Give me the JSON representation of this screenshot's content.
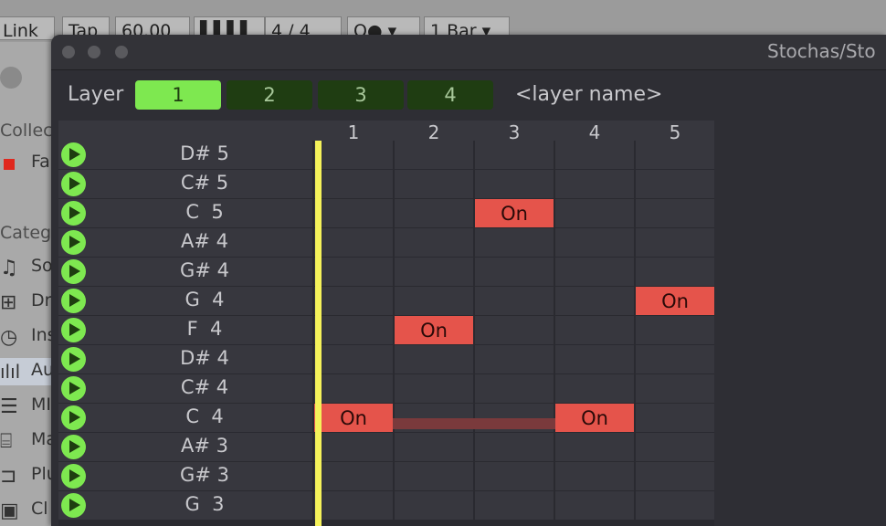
{
  "host": {
    "toolbar": [
      "Link",
      "Tap",
      "60.00",
      "4 / 4",
      "1 Bar"
    ],
    "sidebar": {
      "collections_header": "Collec",
      "collection_item": "Fa",
      "categories_header": "Categ",
      "items": [
        "So",
        "Dr",
        "Ins",
        "Au",
        "MI",
        "Ma",
        "Plu",
        "Cl"
      ]
    }
  },
  "window": {
    "title": "Stochas/Sto"
  },
  "layer": {
    "label": "Layer",
    "tabs": [
      "1",
      "2",
      "3",
      "4"
    ],
    "active_tab": 0,
    "name_placeholder": "<layer name>"
  },
  "grid": {
    "columns": [
      "1",
      "2",
      "3",
      "4",
      "5"
    ],
    "on_label": "On",
    "rows": [
      {
        "note": "D# 5",
        "on": []
      },
      {
        "note": "C# 5",
        "on": []
      },
      {
        "note": "C  5",
        "on": [
          3
        ]
      },
      {
        "note": "A# 4",
        "on": []
      },
      {
        "note": "G# 4",
        "on": []
      },
      {
        "note": "G  4",
        "on": [
          5
        ]
      },
      {
        "note": "F  4",
        "on": [
          2
        ]
      },
      {
        "note": "D# 4",
        "on": []
      },
      {
        "note": "C# 4",
        "on": []
      },
      {
        "note": "C  4",
        "on": [
          1,
          4
        ]
      },
      {
        "note": "A# 3",
        "on": []
      },
      {
        "note": "G# 3",
        "on": []
      },
      {
        "note": "G  3",
        "on": []
      }
    ],
    "ties": [
      {
        "row": 9,
        "from": 1,
        "to": 4
      }
    ]
  },
  "colors": {
    "accent_green": "#7ee850",
    "on_red": "#e5544b",
    "playhead_yellow": "#f5f25a"
  }
}
